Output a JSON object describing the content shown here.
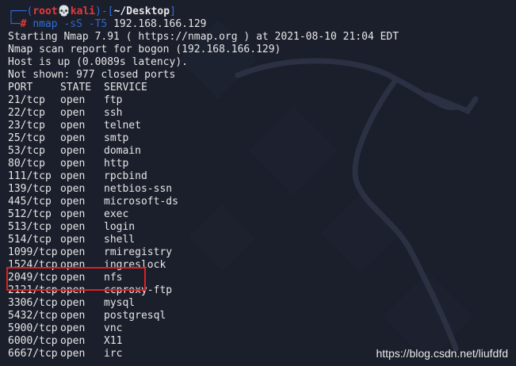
{
  "prompt": {
    "frame_top": "┌──(",
    "user": "root",
    "skull": "💀",
    "host": "kali",
    "sep": ")-[",
    "path": "~/Desktop",
    "frame_close": "]",
    "frame_bottom": "└─",
    "hash": "#",
    "command": "nmap",
    "flags": "-sS -T5",
    "target": "192.168.166.129"
  },
  "output": {
    "lines": [
      "Starting Nmap 7.91 ( https://nmap.org ) at 2021-08-10 21:04 EDT",
      "Nmap scan report for bogon (192.168.166.129)",
      "Host is up (0.0089s latency).",
      "Not shown: 977 closed ports"
    ],
    "header": {
      "port": "PORT",
      "state": "STATE",
      "service": "SERVICE"
    },
    "ports": [
      {
        "port": "21/tcp",
        "state": "open",
        "service": "ftp"
      },
      {
        "port": "22/tcp",
        "state": "open",
        "service": "ssh"
      },
      {
        "port": "23/tcp",
        "state": "open",
        "service": "telnet"
      },
      {
        "port": "25/tcp",
        "state": "open",
        "service": "smtp"
      },
      {
        "port": "53/tcp",
        "state": "open",
        "service": "domain"
      },
      {
        "port": "80/tcp",
        "state": "open",
        "service": "http"
      },
      {
        "port": "111/tcp",
        "state": "open",
        "service": "rpcbind"
      },
      {
        "port": "139/tcp",
        "state": "open",
        "service": "netbios-ssn"
      },
      {
        "port": "445/tcp",
        "state": "open",
        "service": "microsoft-ds"
      },
      {
        "port": "512/tcp",
        "state": "open",
        "service": "exec"
      },
      {
        "port": "513/tcp",
        "state": "open",
        "service": "login"
      },
      {
        "port": "514/tcp",
        "state": "open",
        "service": "shell"
      },
      {
        "port": "1099/tcp",
        "state": "open",
        "service": "rmiregistry"
      },
      {
        "port": "1524/tcp",
        "state": "open",
        "service": "ingreslock"
      },
      {
        "port": "2049/tcp",
        "state": "open",
        "service": "nfs"
      },
      {
        "port": "2121/tcp",
        "state": "open",
        "service": "ccproxy-ftp"
      },
      {
        "port": "3306/tcp",
        "state": "open",
        "service": "mysql"
      },
      {
        "port": "5432/tcp",
        "state": "open",
        "service": "postgresql"
      },
      {
        "port": "5900/tcp",
        "state": "open",
        "service": "vnc"
      },
      {
        "port": "6000/tcp",
        "state": "open",
        "service": "X11"
      },
      {
        "port": "6667/tcp",
        "state": "open",
        "service": "irc"
      }
    ]
  },
  "watermark": "https://blog.csdn.net/liufdfd",
  "colors": {
    "background": "#1b1f2b",
    "prompt_blue": "#2f6fdb",
    "prompt_red": "#e53a3a",
    "text": "#e6e6e6",
    "highlight": "#e02020"
  },
  "icons": {
    "skull": "skull-icon",
    "background": "kali-dragon-icon"
  }
}
